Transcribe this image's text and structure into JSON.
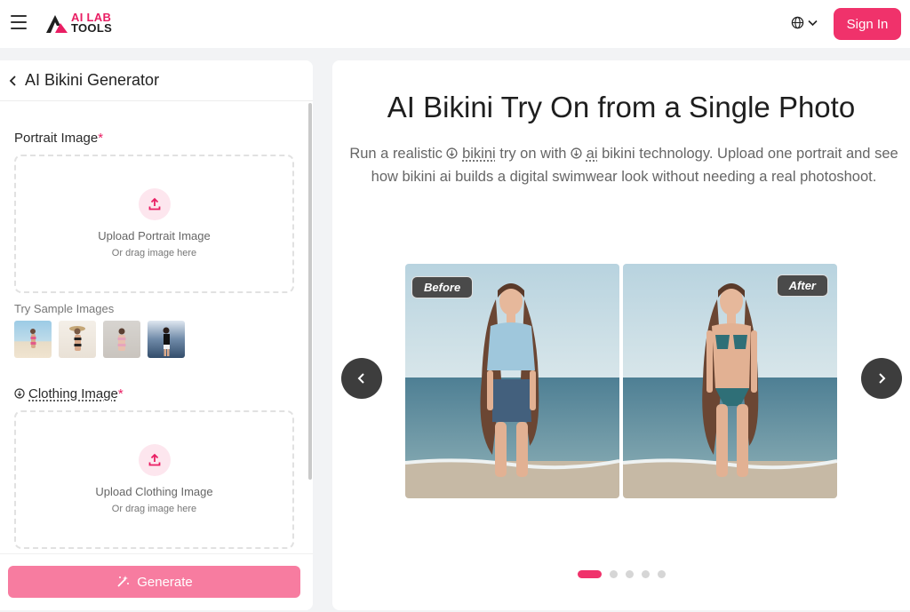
{
  "header": {
    "logo_line1": "AI LAB",
    "logo_line2": "TOOLS",
    "signin_label": "Sign In"
  },
  "left_panel": {
    "title": "AI Bikini Generator",
    "portrait": {
      "label": "Portrait Image",
      "required_mark": "*",
      "upload_text": "Upload Portrait Image",
      "drag_text": "Or drag image here"
    },
    "samples_label": "Try Sample Images",
    "clothing": {
      "label": "Clothing Image",
      "required_mark": "*",
      "upload_text": "Upload Clothing Image",
      "drag_text": "Or drag image here"
    },
    "generate_label": "Generate"
  },
  "hero": {
    "title": "AI Bikini Try On from a Single Photo",
    "sub_part1": "Run a realistic",
    "sub_link1": "bikini",
    "sub_part2": "try on with",
    "sub_link2": "ai",
    "sub_part3": "bikini technology. Upload one portrait and see how bikini ai builds a digital swimwear look without needing a real photoshoot.",
    "before_tag": "Before",
    "after_tag": "After"
  },
  "colors": {
    "accent": "#f0326b",
    "generate_bg": "#f77ca0"
  }
}
